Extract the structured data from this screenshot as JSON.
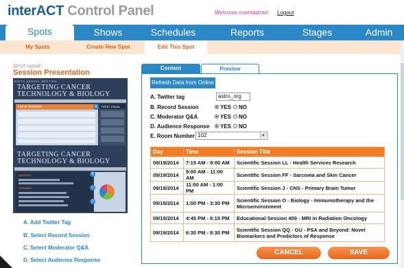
{
  "header": {
    "logo_bold": "interACT",
    "logo_rest": " Control Panel",
    "welcome": "Welcome eventadmin!",
    "logout": "Logout"
  },
  "nav": [
    "Spots",
    "Shows",
    "Schedules",
    "Reports",
    "Stages",
    "Admin"
  ],
  "subnav": [
    "My Spots",
    "Create New Spot",
    "Edit This Spot"
  ],
  "spot": {
    "label": "SPOT NAME:",
    "title": "Session Presentation"
  },
  "preview_screen": {
    "band_text": "NINTH ANNUAL MEETING",
    "title_line1": "TARGETING CANCER",
    "title_line2": "TECHNOLOGY & BIOLOGY",
    "panel_header": "List of Sessions",
    "side_header": "TWEET #Tanks",
    "session_label": "SESSION",
    "speaker_label": "SPEAKER",
    "badge_a": "A",
    "badge_b": "B",
    "badge_c": "C",
    "badge_d": "D"
  },
  "actions": [
    "A. Add Twitter Tag",
    "B. Select Record Session",
    "C. Select Moderator Q&A",
    "D. Select Audience Response"
  ],
  "tabs": [
    "Content",
    "Preview"
  ],
  "refresh_label": "Refresh Data from Online",
  "form": {
    "twitter_label": "A. Twitter tag",
    "twitter_value": "astro_org",
    "record_label": "B. Record Session",
    "moderator_label": "C. Moderator Q&A",
    "audience_label": "D. Audience Response",
    "room_label": "E. Room Number",
    "room_value": "102",
    "yes": "YES",
    "no": "NO"
  },
  "table": {
    "headers": [
      "Day",
      "Time",
      "Session Title"
    ],
    "rows": [
      [
        "09/19/2014",
        "7:15 AM - 9:00 AM",
        "Scientific Session LL - Health Services Research"
      ],
      [
        "09/19/2014",
        "9:00 AM - 11:00 AM",
        "Scientific Session FF - Sarcoma and Skin Cancer"
      ],
      [
        "09/19/2014",
        "11:00 AM - 1:00 PM",
        "Scientific Session J - CNS - Primary Brain Tumor"
      ],
      [
        "09/19/2014",
        "1:00 PM - 3:30 PM",
        "Scientific Session O - Biology - Immumotherapy and the Microenvironment"
      ],
      [
        "09/19/2014",
        "4:45 PM - 6:15 PM",
        "Educational Session 409 - MRI in Radiation Oncology"
      ],
      [
        "09/19/2014",
        "6:30 PM - 8:30 PM",
        "Scientific Session QQ - GU - PSA and Beyond: Novel Biomarkers and Predictors of Response"
      ]
    ]
  },
  "buttons": {
    "cancel": "CANCEL",
    "save": "SAVE"
  }
}
